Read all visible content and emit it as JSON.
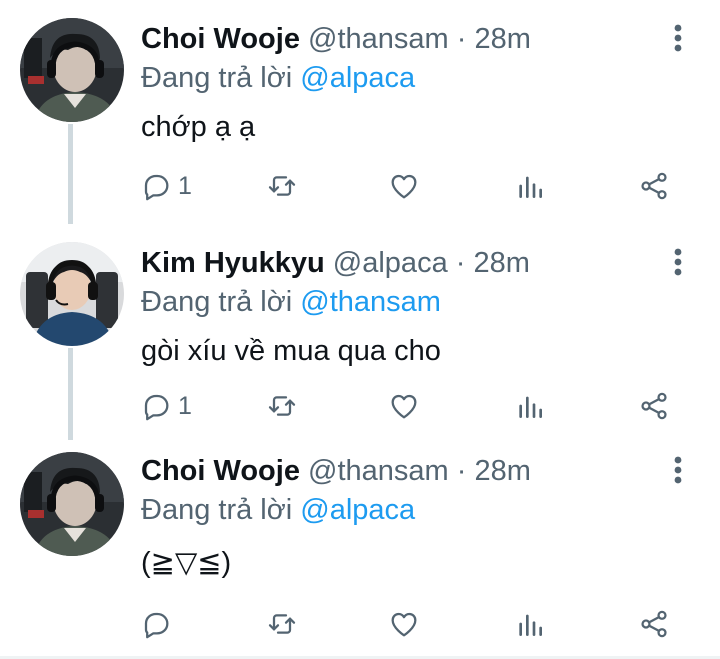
{
  "icons": {
    "reply": "reply-icon",
    "retweet": "retweet-icon",
    "like": "heart-icon",
    "stats": "bar-chart-icon",
    "share": "share-icon",
    "more": "more-options-icon"
  },
  "colors": {
    "text": "#0f1419",
    "secondary": "#536471",
    "link": "#1d9bf0",
    "connector": "#cfd9de"
  },
  "tweets": [
    {
      "display_name": "Choi Wooje",
      "handle": "@thansam",
      "separator": "·",
      "time": "28m",
      "reply_prefix": "Đang trả lời",
      "reply_to": "@alpaca",
      "text": "chớp ạ ạ",
      "reply_count": "1"
    },
    {
      "display_name": "Kim Hyukkyu",
      "handle": "@alpaca",
      "separator": "·",
      "time": "28m",
      "reply_prefix": "Đang trả lời",
      "reply_to": "@thansam",
      "text": "gòi xíu về mua qua cho",
      "reply_count": "1"
    },
    {
      "display_name": "Choi Wooje",
      "handle": "@thansam",
      "separator": "·",
      "time": "28m",
      "reply_prefix": "Đang trả lời",
      "reply_to": "@alpaca",
      "text": "(≧▽≦)",
      "reply_count": ""
    }
  ]
}
